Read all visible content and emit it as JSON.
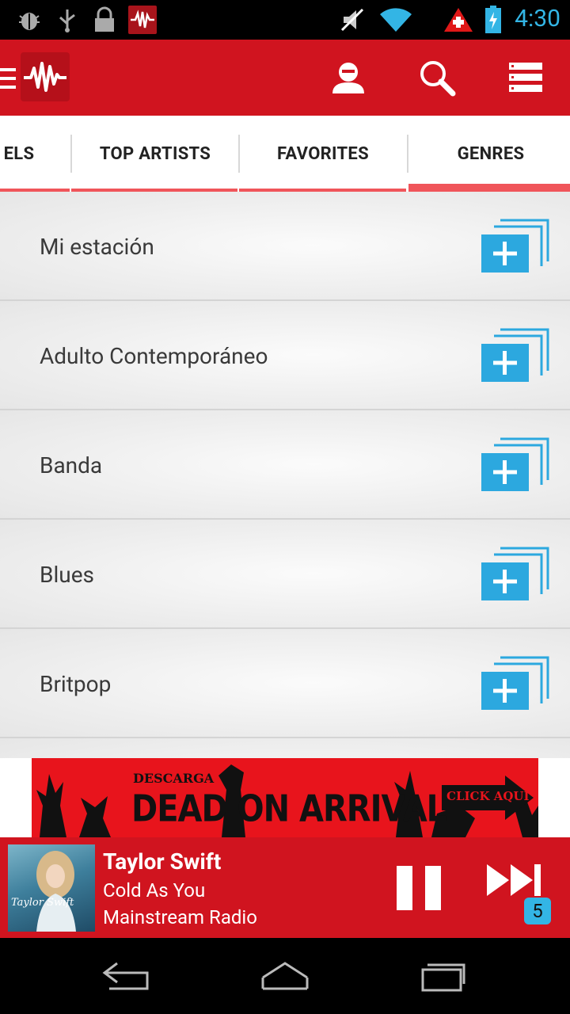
{
  "status_bar": {
    "time": "4:30",
    "icons": [
      "bug-icon",
      "usb-icon",
      "lock-icon",
      "app-notification-icon",
      "mute-icon",
      "wifi-icon",
      "warning-icon",
      "battery-icon"
    ]
  },
  "action_bar": {
    "icons": [
      "hamburger-icon",
      "app-logo-icon",
      "profile-icon",
      "search-icon",
      "menu-list-icon"
    ]
  },
  "tabs": [
    {
      "label": "ELS"
    },
    {
      "label": "TOP ARTISTS"
    },
    {
      "label": "FAVORITES"
    },
    {
      "label": "GENRES",
      "active": true
    }
  ],
  "genres": [
    {
      "label": "Mi estación"
    },
    {
      "label": "Adulto Contemporáneo"
    },
    {
      "label": "Banda"
    },
    {
      "label": "Blues"
    },
    {
      "label": "Britpop"
    }
  ],
  "ad": {
    "top_text": "DESCARGA",
    "main_text": "DEAD ON ARRIVAL",
    "cta": "CLICK AQUÍ"
  },
  "player": {
    "artist": "Taylor Swift",
    "song": "Cold As You",
    "station": "Mainstream Radio",
    "album_text": "Taylor Swift",
    "queue_count": "5"
  },
  "colors": {
    "brand_red": "#d0141f",
    "accent_blue": "#33b5e5",
    "tab_indicator": "#f0555a"
  }
}
